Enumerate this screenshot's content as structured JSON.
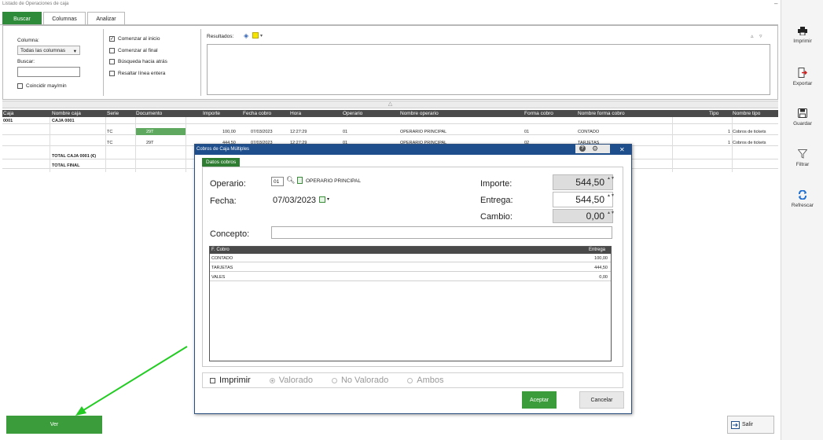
{
  "window": {
    "title": "Listado de Operaciones de caja"
  },
  "tabs": [
    "Buscar",
    "Columnas",
    "Analizar"
  ],
  "search": {
    "columna_label": "Columna:",
    "columna_value": "Todas las columnas",
    "buscar_label": "Buscar:",
    "buscar_value": "",
    "coincidir": "Coincidir may/min",
    "options": [
      {
        "label": "Comenzar al inicio",
        "checked": true
      },
      {
        "label": "Comenzar al final",
        "checked": false
      },
      {
        "label": "Búsqueda hacia atrás",
        "checked": false
      },
      {
        "label": "Resaltar línea entera",
        "checked": false
      }
    ],
    "resultados_label": "Resultados:"
  },
  "table": {
    "headers": [
      "Caja",
      "Nombre caja",
      "Serie",
      "Documento",
      "Importe",
      "Fecha cobro",
      "Hora",
      "Operario",
      "Nombre operario",
      "Forma cobro",
      "Nombre forma cobro",
      "Tipo",
      "Nombre tipo"
    ],
    "rows": [
      {
        "caja": "0001",
        "nombre": "CAJA 0001"
      },
      {
        "serie": "TC",
        "doc": "29T",
        "importe": "100,00",
        "fecha": "07/03/2023",
        "hora": "12:27:29",
        "operario": "01",
        "nombre_operario": "OPERARIO PRINCIPAL",
        "forma": "01",
        "nombre_forma": "CONTADO",
        "tipo": "1",
        "nombre_tipo": "Cobros de tickets"
      },
      {
        "serie": "TC",
        "doc": "29T",
        "importe": "444,50",
        "fecha": "07/03/2023",
        "hora": "12:27:29",
        "operario": "01",
        "nombre_operario": "OPERARIO PRINCIPAL",
        "forma": "02",
        "nombre_forma": "TARJETAS",
        "tipo": "1",
        "nombre_tipo": "Cobros de tickets"
      },
      {
        "nombre": "TOTAL CAJA 0001 (€)"
      },
      {
        "nombre": "TOTAL FINAL"
      }
    ]
  },
  "toolbar": {
    "items": [
      {
        "label": "Imprimir",
        "icon": "printer-icon"
      },
      {
        "label": "Exportar",
        "icon": "export-icon"
      },
      {
        "label": "Guardar",
        "icon": "save-icon"
      },
      {
        "label": "Filtrar",
        "icon": "filter-icon"
      },
      {
        "label": "Refrescar",
        "icon": "refresh-icon"
      }
    ]
  },
  "bottom": {
    "ver": "Ver",
    "salir": "Salir"
  },
  "modal": {
    "title": "Cobros de Caja Múltiples",
    "tab": "Datos cobros",
    "operario_label": "Operario:",
    "operario_code": "01",
    "operario_name": "OPERARIO PRINCIPAL",
    "fecha_label": "Fecha:",
    "fecha_value": "07/03/2023",
    "importe_label": "Importe:",
    "importe_value": "544,50",
    "entrega_label": "Entrega:",
    "entrega_value": "544,50",
    "cambio_label": "Cambio:",
    "cambio_value": "0,00",
    "concepto_label": "Concepto:",
    "concepto_value": "",
    "grid_headers": [
      "F. Cobro",
      "Entrega"
    ],
    "grid_rows": [
      {
        "forma": "CONTADO",
        "entrega": "100,00"
      },
      {
        "forma": "TARJETAS",
        "entrega": "444,50"
      },
      {
        "forma": "VALES",
        "entrega": "0,00"
      }
    ],
    "imprimir_label": "Imprimir",
    "radios": [
      {
        "label": "Valorado",
        "selected": true
      },
      {
        "label": "No Valorado",
        "selected": false
      },
      {
        "label": "Ambos",
        "selected": false
      }
    ],
    "aceptar": "Aceptar",
    "cancelar": "Cancelar"
  },
  "colors": {
    "accent_green": "#3b9c3b",
    "modal_blue": "#1e4e8c",
    "header_dark": "#4a4a4a",
    "highlight_cell": "#5fa85f"
  }
}
